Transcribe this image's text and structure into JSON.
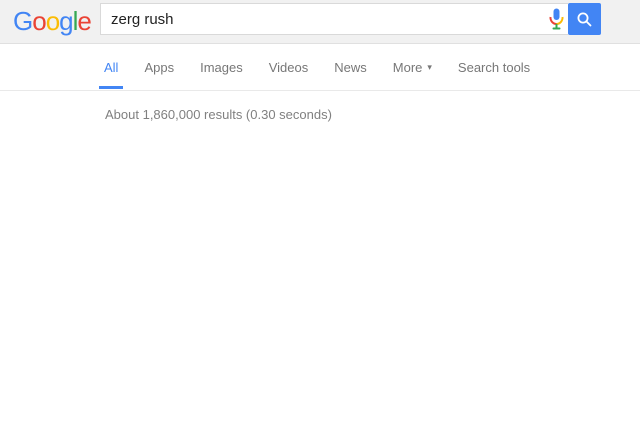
{
  "logo": {
    "letters": [
      {
        "ch": "G",
        "color": "#4285F4"
      },
      {
        "ch": "o",
        "color": "#EA4335"
      },
      {
        "ch": "o",
        "color": "#FBBC05"
      },
      {
        "ch": "g",
        "color": "#4285F4"
      },
      {
        "ch": "l",
        "color": "#34A853"
      },
      {
        "ch": "e",
        "color": "#EA4335"
      }
    ]
  },
  "search": {
    "value": "zerg rush",
    "mic_icon": "google-mic-icon",
    "button_icon": "magnifier-icon"
  },
  "tabs": {
    "items": [
      {
        "label": "All",
        "active": true,
        "has_dropdown": false
      },
      {
        "label": "Apps",
        "active": false,
        "has_dropdown": false
      },
      {
        "label": "Images",
        "active": false,
        "has_dropdown": false
      },
      {
        "label": "Videos",
        "active": false,
        "has_dropdown": false
      },
      {
        "label": "News",
        "active": false,
        "has_dropdown": false
      },
      {
        "label": "More",
        "active": false,
        "has_dropdown": true
      },
      {
        "label": "Search tools",
        "active": false,
        "has_dropdown": false
      }
    ],
    "dropdown_arrow_glyph": "▾"
  },
  "stats": {
    "text": "About 1,860,000 results (0.30 seconds)"
  },
  "colors": {
    "accent_blue": "#4285f4",
    "header_background": "#f1f1f1",
    "tab_inactive_text": "#777777",
    "stats_text": "#808080",
    "input_border": "#d9d9d9"
  }
}
